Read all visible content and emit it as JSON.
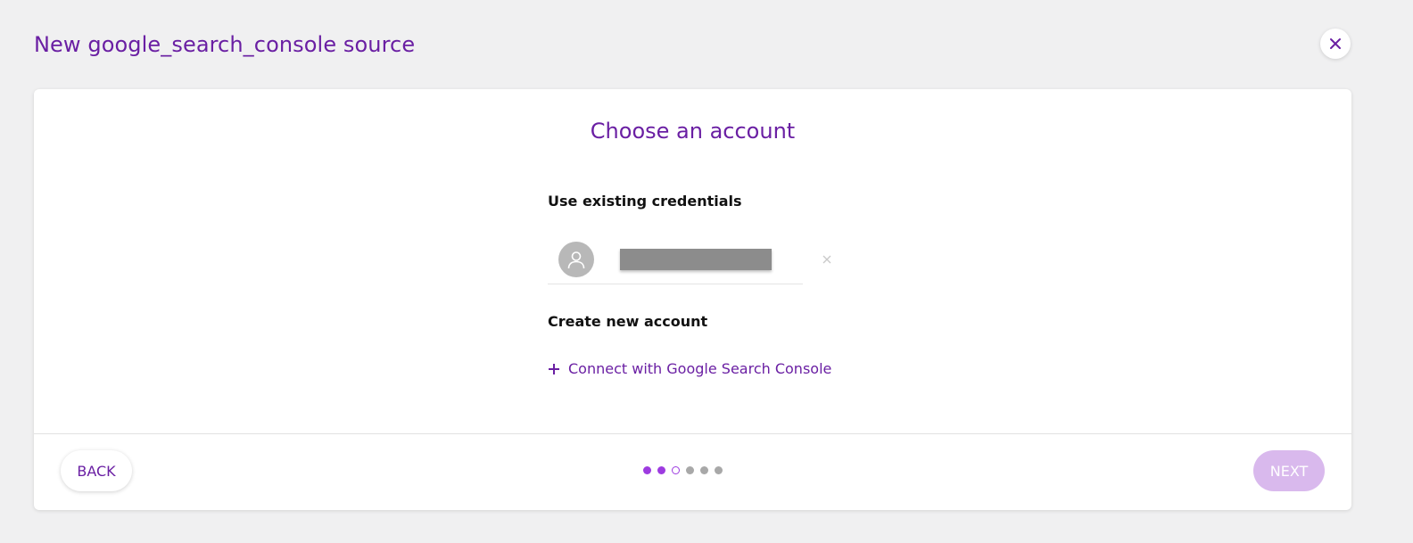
{
  "page": {
    "title": "New google_search_console source"
  },
  "card": {
    "title": "Choose an account",
    "existing_label": "Use existing credentials",
    "account": {
      "name": "",
      "redacted": true
    },
    "create_label": "Create new account",
    "connect_label": "Connect with Google Search Console"
  },
  "footer": {
    "back_label": "BACK",
    "next_label": "NEXT",
    "next_enabled": false
  },
  "stepper": {
    "steps": [
      "done",
      "done",
      "current",
      "todo",
      "todo",
      "todo"
    ]
  },
  "icons": {
    "close": "close-icon",
    "avatar": "user-icon",
    "remove": "remove-icon",
    "add": "plus-icon"
  },
  "colors": {
    "accent": "#6a1fa3",
    "step_active": "#9d3be0",
    "step_inactive": "#a8a8a8",
    "next_disabled": "#d9b9ed",
    "background": "#f0f0f1"
  }
}
